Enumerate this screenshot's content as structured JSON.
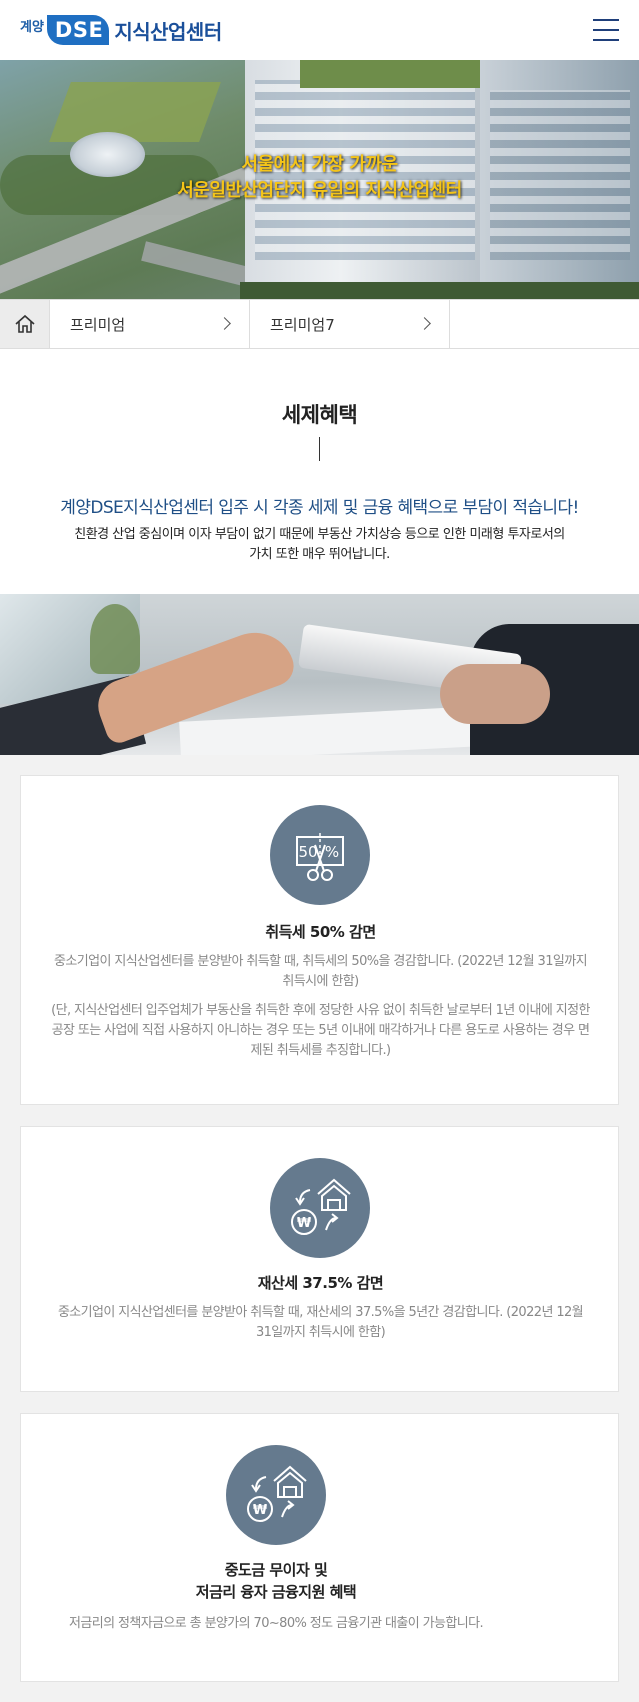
{
  "header": {
    "logo_small": "계양",
    "logo_dse": "DSE",
    "logo_text": "지식산업센터",
    "menu_icon": "hamburger-menu-icon"
  },
  "hero": {
    "line1": "서울에서 가장 가까운",
    "line2": "서운일반산업단지 유일의 지식산업센터",
    "accent_color": "#f5c518"
  },
  "breadcrumb": {
    "home_icon": "home-icon",
    "items": [
      {
        "label": "프리미엄"
      },
      {
        "label": "프리미엄7"
      }
    ]
  },
  "intro": {
    "title": "세제혜택",
    "lead": "계양DSE지식산업센터 입주 시 각종 세제 및 금융 혜택으로 부담이 적습니다!",
    "sub": "친환경 산업 중심이며 이자 부담이 없기 때문에 부동산 가치상승 등으로 인한 미래형 투자로서의 가치 또한 매우 뛰어납니다.",
    "lead_color": "#1f4f86"
  },
  "benefits": [
    {
      "icon": "discount-coupon-icon",
      "icon_text": "50%",
      "title": "취득세 50% 감면",
      "desc": "중소기업이 지식산업센터를 분양받아 취득할 때, 취득세의 50%을 경감합니다. (2022년 12월 31일까지 취득시에 한함)",
      "note": "(단, 지식산업센터 입주업체가 부동산을 취득한 후에 정당한 사유 없이 취득한 날로부터 1년 이내에 지정한 공장 또는 사업에 직접 사용하지 아니하는 경우 또는 5년 이내에 매각하거나 다른 용도로 사용하는 경우 면제된 취득세를 추징합니다.)"
    },
    {
      "icon": "property-money-exchange-icon",
      "title": "재산세 37.5% 감면",
      "desc": "중소기업이 지식산업센터를 분양받아 취득할 때, 재산세의 37.5%을 5년간 경감합니다. (2022년 12월 31일까지 취득시에 한함)"
    },
    {
      "icon": "property-money-exchange-icon",
      "title_line1": "중도금 무이자 및",
      "title_line2": "저금리 융자 금융지원 혜택",
      "desc": "저금리의 정책자금으로 총 분양가의 70~80% 정도 금융기관 대출이 가능합니다."
    }
  ],
  "icon_circle_color": "#657a8e"
}
